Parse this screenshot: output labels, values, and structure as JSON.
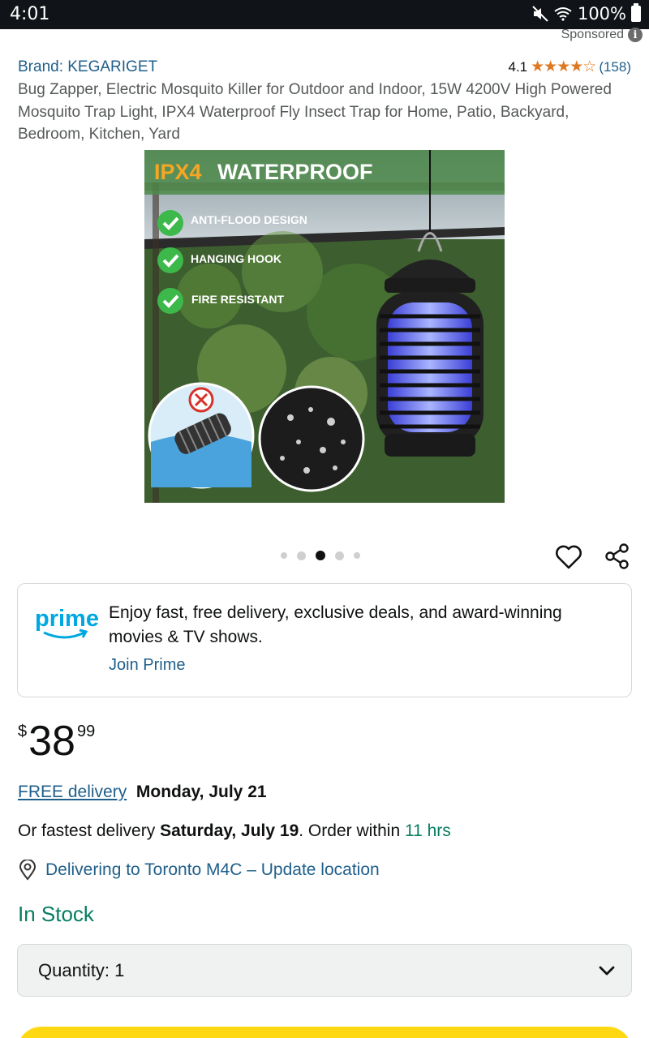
{
  "status_bar": {
    "time": "4:01",
    "battery": "100%"
  },
  "sponsored": {
    "label": "Sponsored",
    "info": "i"
  },
  "product": {
    "brand": "Brand: KEGARIGET",
    "rating": "4.1",
    "rating_value": 4.1,
    "stars": "★★★★☆",
    "review_count": "(158)",
    "title": "Bug Zapper, Electric Mosquito Killer for Outdoor and Indoor, 15W 4200V High Powered Mosquito Trap Light, IPX4 Waterproof Fly Insect Trap for Home, Patio, Backyard, Bedroom, Kitchen, Yard"
  },
  "image": {
    "heading_accent": "IPX4",
    "heading_rest": "WATERPROOF",
    "features": [
      "ANTI-FLOOD DESIGN",
      "HANGING HOOK",
      "FIRE RESISTANT"
    ],
    "carousel_count": 5,
    "carousel_active": 3
  },
  "prime": {
    "logo_text": "prime",
    "message": "Enjoy fast, free delivery, exclusive deals, and award-winning movies & TV shows.",
    "join_label": "Join Prime"
  },
  "price": {
    "symbol": "$",
    "whole": "38",
    "fraction": "99"
  },
  "delivery": {
    "free_label": "FREE delivery",
    "free_date": "Monday, July 21",
    "fastest_prefix": "Or fastest delivery ",
    "fastest_date": "Saturday, July 19",
    "order_within": ". Order within ",
    "time_left": "11 hrs"
  },
  "location": {
    "label": "Delivering to Toronto M4C – Update location"
  },
  "stock": {
    "label": "In Stock"
  },
  "quantity": {
    "label": "Quantity:",
    "value": "1"
  },
  "colors": {
    "link": "#1f5f8b",
    "green": "#067d62",
    "star": "#de7921",
    "prime_blue": "#00a8e1",
    "add_button": "#ffd814"
  }
}
